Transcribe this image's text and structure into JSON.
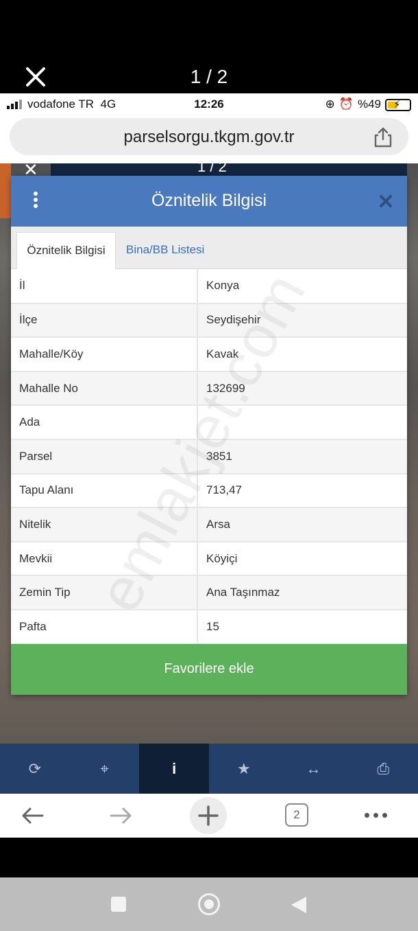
{
  "viewer": {
    "counter": "1 / 2"
  },
  "status_bar": {
    "carrier": "vodafone TR",
    "network": "4G",
    "time": "12:26",
    "battery": "%49"
  },
  "browser": {
    "url": "parselsorgu.tkgm.gov.tr",
    "tab_count": "2"
  },
  "background": {
    "counter": "1 / 2"
  },
  "modal": {
    "title": "Öznitelik Bilgisi",
    "tabs": [
      {
        "label": "Öznitelik Bilgisi",
        "active": true
      },
      {
        "label": "Bina/BB Listesi",
        "active": false
      }
    ],
    "rows": [
      {
        "key": "İl",
        "value": "Konya"
      },
      {
        "key": "İlçe",
        "value": "Seydişehir"
      },
      {
        "key": "Mahalle/Köy",
        "value": "Kavak"
      },
      {
        "key": "Mahalle No",
        "value": "132699"
      },
      {
        "key": "Ada",
        "value": ""
      },
      {
        "key": "Parsel",
        "value": "3851"
      },
      {
        "key": "Tapu Alanı",
        "value": "713,47"
      },
      {
        "key": "Nitelik",
        "value": "Arsa"
      },
      {
        "key": "Mevkii",
        "value": "Köyiçi"
      },
      {
        "key": "Zemin Tip",
        "value": "Ana Taşınmaz"
      },
      {
        "key": "Pafta",
        "value": "15"
      }
    ],
    "favorite_button": "Favorilere ekle"
  },
  "watermark": "emlakjet.com",
  "toolbar": {
    "items": [
      {
        "name": "refresh-icon",
        "glyph": "⟳"
      },
      {
        "name": "locate-icon",
        "glyph": "⌖"
      },
      {
        "name": "info-icon",
        "glyph": "i"
      },
      {
        "name": "star-icon",
        "glyph": "★"
      },
      {
        "name": "measure-icon",
        "glyph": "↔"
      },
      {
        "name": "print-icon",
        "glyph": "⎙"
      }
    ]
  },
  "colors": {
    "header_blue": "#4b79bd",
    "tab_link_blue": "#3a6fb6",
    "favorite_green": "#5cb15a",
    "toolbar_navy": "#24406a",
    "toolbar_active": "#0f1f36"
  }
}
